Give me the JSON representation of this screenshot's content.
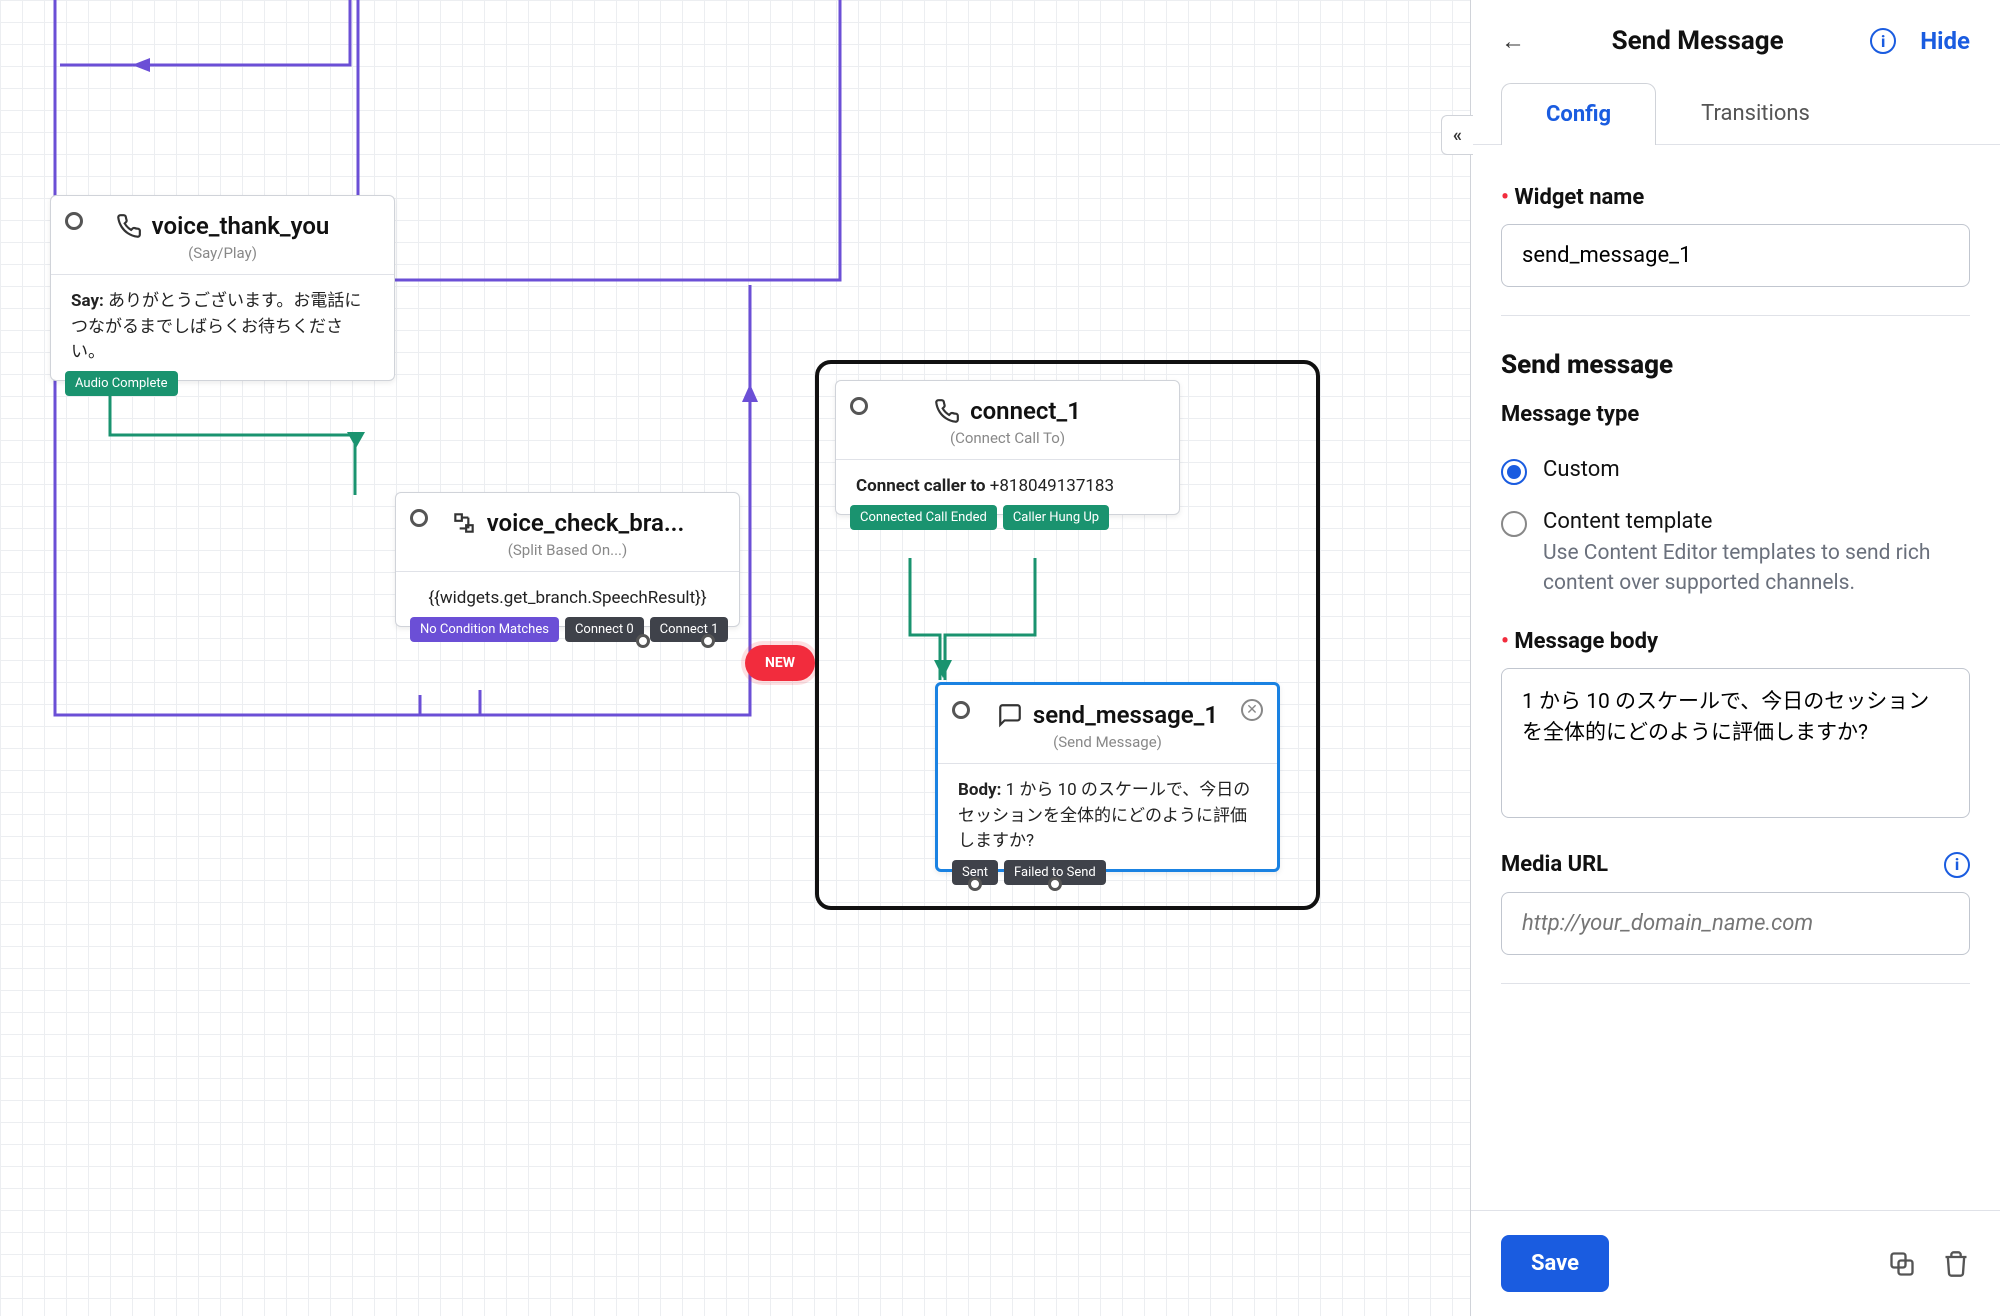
{
  "canvas": {
    "thank_you": {
      "title": "voice_thank_you",
      "subtitle": "(Say/Play)",
      "body_label": "Say:",
      "body_text": "ありがとうございます。お電話につながるまでしばらくお待ちください。",
      "pill": "Audio Complete"
    },
    "check_branch": {
      "title": "voice_check_bra...",
      "subtitle": "(Split Based On...)",
      "body_text": "{{widgets.get_branch.SpeechResult}}",
      "pill_no_match": "No Condition Matches",
      "pill_c0": "Connect 0",
      "pill_c1": "Connect 1",
      "new_label": "NEW"
    },
    "connect": {
      "title": "connect_1",
      "subtitle": "(Connect Call To)",
      "body_label": "Connect caller to",
      "body_text": "+818049137183",
      "pill_ended": "Connected Call Ended",
      "pill_hung": "Caller Hung Up"
    },
    "send_message": {
      "title": "send_message_1",
      "subtitle": "(Send Message)",
      "body_label": "Body:",
      "body_text": "1 から 10 のスケールで、今日のセッションを全体的にどのように評価しますか?",
      "pill_sent": "Sent",
      "pill_failed": "Failed to Send"
    }
  },
  "panel": {
    "title": "Send Message",
    "hide": "Hide",
    "tab_config": "Config",
    "tab_transitions": "Transitions",
    "widget_name_label": "Widget name",
    "widget_name_value": "send_message_1",
    "section": "Send message",
    "message_type_label": "Message type",
    "radio_custom": "Custom",
    "radio_template": "Content template",
    "radio_template_desc": "Use Content Editor templates to send rich content over supported channels.",
    "message_body_label": "Message body",
    "message_body_value": "1 から 10 のスケールで、今日のセッションを全体的にどのように評価しますか?",
    "media_url_label": "Media URL",
    "media_url_placeholder": "http://your_domain_name.com",
    "save": "Save"
  }
}
